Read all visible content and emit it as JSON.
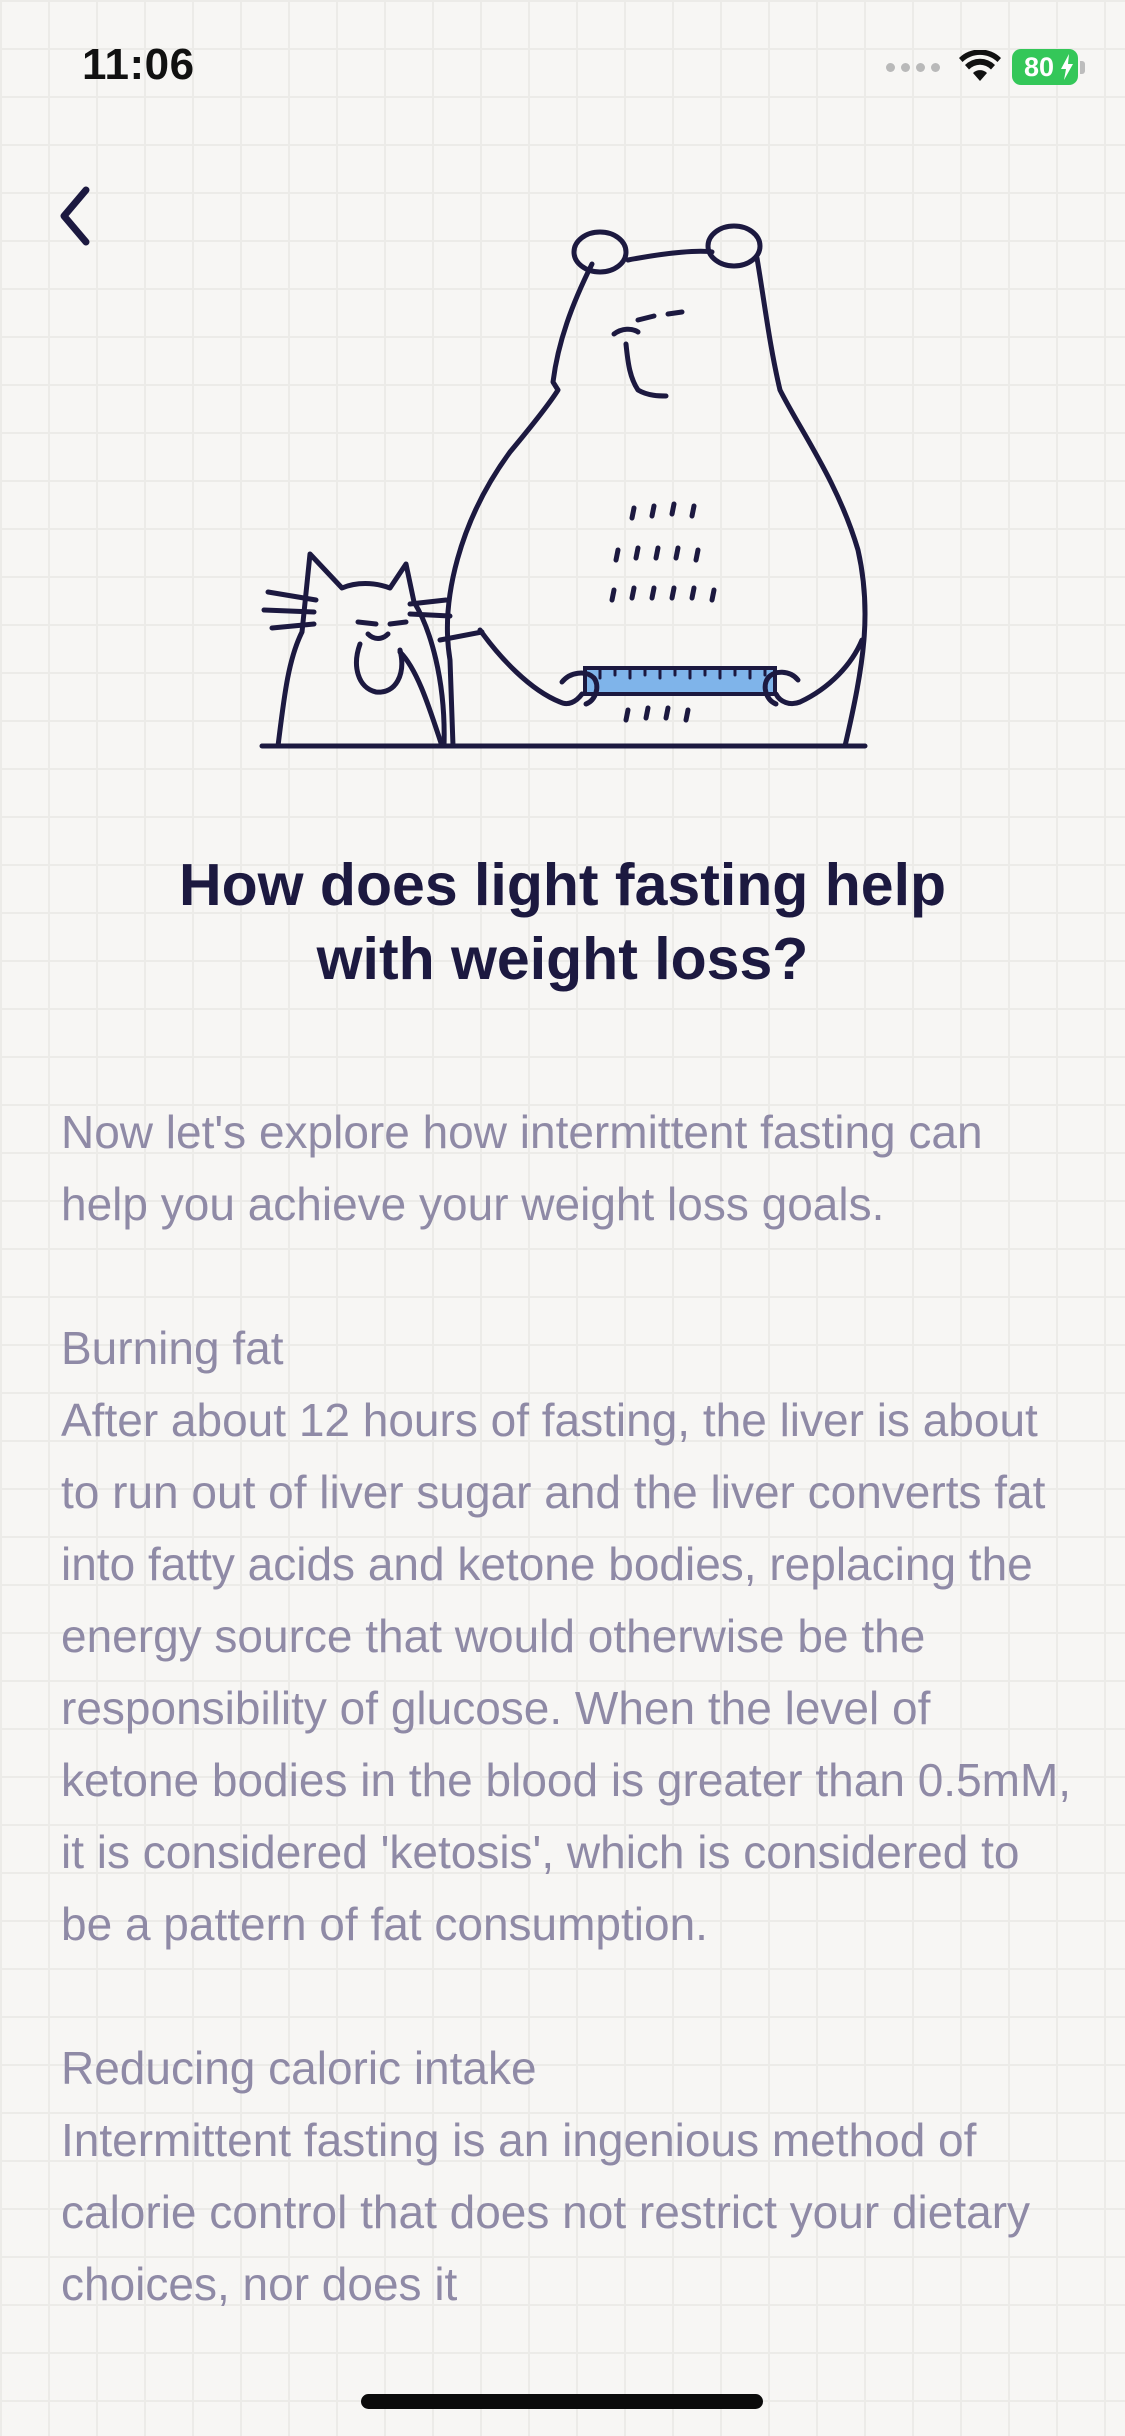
{
  "status_bar": {
    "time": "11:06",
    "battery_percent": "80",
    "battery_color": "#34c759",
    "icons": [
      "signal-dots-icon",
      "wifi-icon",
      "battery-icon",
      "charging-bolt-icon"
    ]
  },
  "nav": {
    "back_icon": "chevron-left-icon"
  },
  "hero": {
    "illustration": "bear-and-cat-with-tape-measure",
    "accent_color": "#7fb4ea",
    "ink_color": "#1c1940"
  },
  "article": {
    "title_line1": "How does light fasting help",
    "title_line2": "with weight loss?",
    "intro": "Now let's explore how intermittent fasting can help you achieve your weight loss goals.",
    "sections": [
      {
        "heading": "Burning fat",
        "body": "After about 12 hours of fasting, the liver is about to run out of liver sugar and the liver converts fat into fatty acids and ketone bodies, replacing the energy source that would otherwise be the responsibility of glucose. When the level of ketone bodies in the blood is greater than 0.5mM, it is considered 'ketosis', which is considered to be a pattern of fat consumption."
      },
      {
        "heading": "Reducing caloric intake",
        "body": "Intermittent fasting is an ingenious method of calorie control that does not restrict your dietary choices, nor does it"
      }
    ]
  },
  "colors": {
    "background": "#f7f6f4",
    "title": "#1c1940",
    "body_text": "#8f8aa6"
  }
}
